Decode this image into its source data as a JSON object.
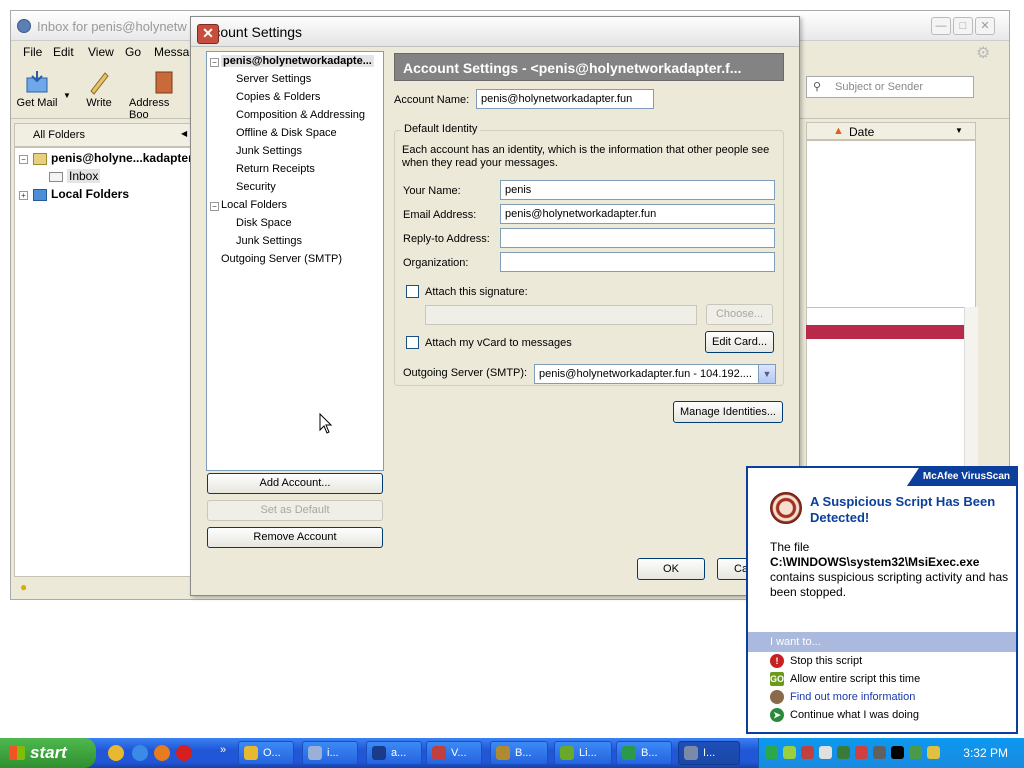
{
  "thunderbird": {
    "window_title": "Inbox for penis@holynetw",
    "menu": [
      "File",
      "Edit",
      "View",
      "Go",
      "Messag"
    ],
    "toolbar": {
      "get_mail": "Get Mail",
      "write": "Write",
      "address_book": "Address Boo"
    },
    "folder_pane_header": "All Folders",
    "folders": {
      "account": "penis@holyne...kadapter.",
      "inbox": "Inbox",
      "local": "Local Folders"
    },
    "search_placeholder": "Subject or Sender",
    "column_date": "Date"
  },
  "dialog": {
    "title": "Account Settings",
    "tree": {
      "account": "penis@holynetworkadapte...",
      "account_children": [
        "Server Settings",
        "Copies & Folders",
        "Composition & Addressing",
        "Offline & Disk Space",
        "Junk Settings",
        "Return Receipts",
        "Security"
      ],
      "local": "Local Folders",
      "local_children": [
        "Disk Space",
        "Junk Settings"
      ],
      "smtp": "Outgoing Server (SMTP)"
    },
    "buttons": {
      "add_account": "Add Account...",
      "set_default": "Set as Default",
      "remove_account": "Remove Account",
      "ok": "OK",
      "cancel": "Ca"
    },
    "header": "Account Settings - <penis@holynetworkadapter.f...",
    "account_name_label": "Account Name:",
    "account_name": "penis@holynetworkadapter.fun",
    "identity_legend": "Default Identity",
    "identity_desc": "Each account has an identity, which is the information that other people see when they read your messages.",
    "your_name_label": "Your Name:",
    "your_name": "penis",
    "email_label": "Email Address:",
    "email": "penis@holynetworkadapter.fun",
    "reply_to_label": "Reply-to Address:",
    "reply_to": "",
    "organization_label": "Organization:",
    "organization": "",
    "attach_signature_label": "Attach this signature:",
    "choose_button": "Choose...",
    "attach_vcard_label": "Attach my vCard to messages",
    "edit_card_button": "Edit Card...",
    "smtp_label": "Outgoing Server (SMTP):",
    "smtp_value": "penis@holynetworkadapter.fun - 104.192....",
    "manage_identities_button": "Manage Identities..."
  },
  "mcafee": {
    "brand": "McAfee VirusScan",
    "title": "A Suspicious Script Has Been Detected!",
    "body_line1": "The file",
    "body_file": "C:\\WINDOWS\\system32\\MsiExec.exe",
    "body_line3": "contains suspicious scripting activity and has been stopped.",
    "want_header": "I want to...",
    "options": [
      "Stop this script",
      "Allow entire script this time",
      "Find out more information",
      "Continue what I was doing"
    ]
  },
  "taskbar": {
    "start": "start",
    "tasks": [
      "O...",
      "i...",
      "a...",
      "V...",
      "B...",
      "Li...",
      "B...",
      "I..."
    ],
    "clock": "3:32 PM"
  },
  "colors": {
    "mcafee_blue": "#0c3f9c",
    "taskbar_blue": "#2157d7",
    "start_green": "#2f8f2f",
    "alert_red": "#b8294a"
  }
}
